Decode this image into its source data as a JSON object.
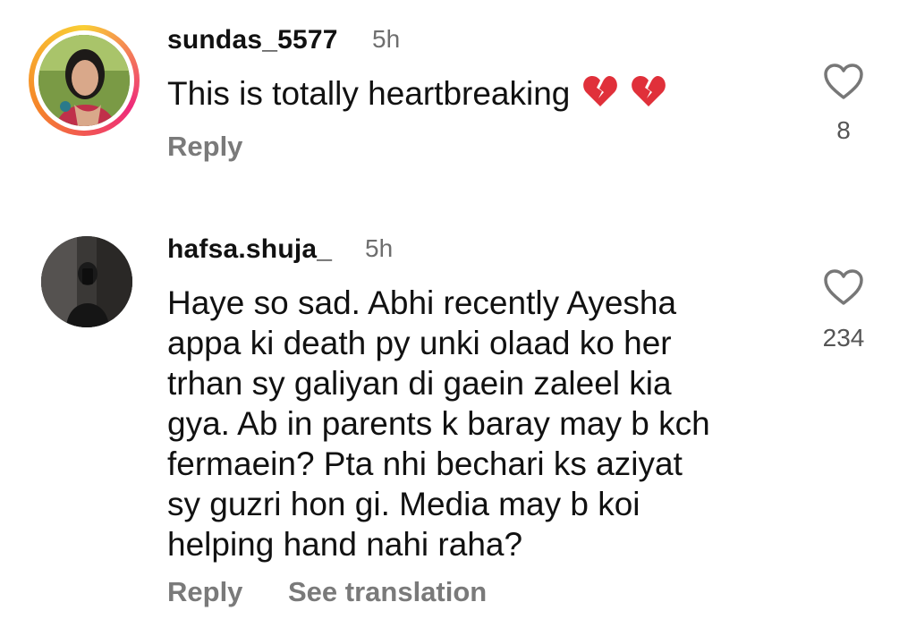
{
  "comments": [
    {
      "username": "sundas_5577",
      "time": "5h",
      "text": "This is totally heartbreaking",
      "emojis": [
        "broken-heart-icon",
        "broken-heart-icon"
      ],
      "reply_label": "Reply",
      "likes": "8"
    },
    {
      "username": "hafsa.shuja_",
      "time": "5h",
      "text": "Haye so sad. Abhi recently Ayesha\nappa ki death py unki olaad ko her\ntrhan sy galiyan di gaein zaleel kia\ngya. Ab in parents k baray may b kch\nfermaein? Pta nhi bechari ks aziyat\nsy guzri hon gi. Media may b koi\nhelping hand nahi raha?",
      "reply_label": "Reply",
      "translate_label": "See translation",
      "likes": "234"
    }
  ],
  "colors": {
    "text": "#111111",
    "muted": "#7a7a7a",
    "broken_heart": "#e0303a",
    "story_ring": [
      "#f9ce34",
      "#ee2a7b",
      "#f58529"
    ]
  }
}
